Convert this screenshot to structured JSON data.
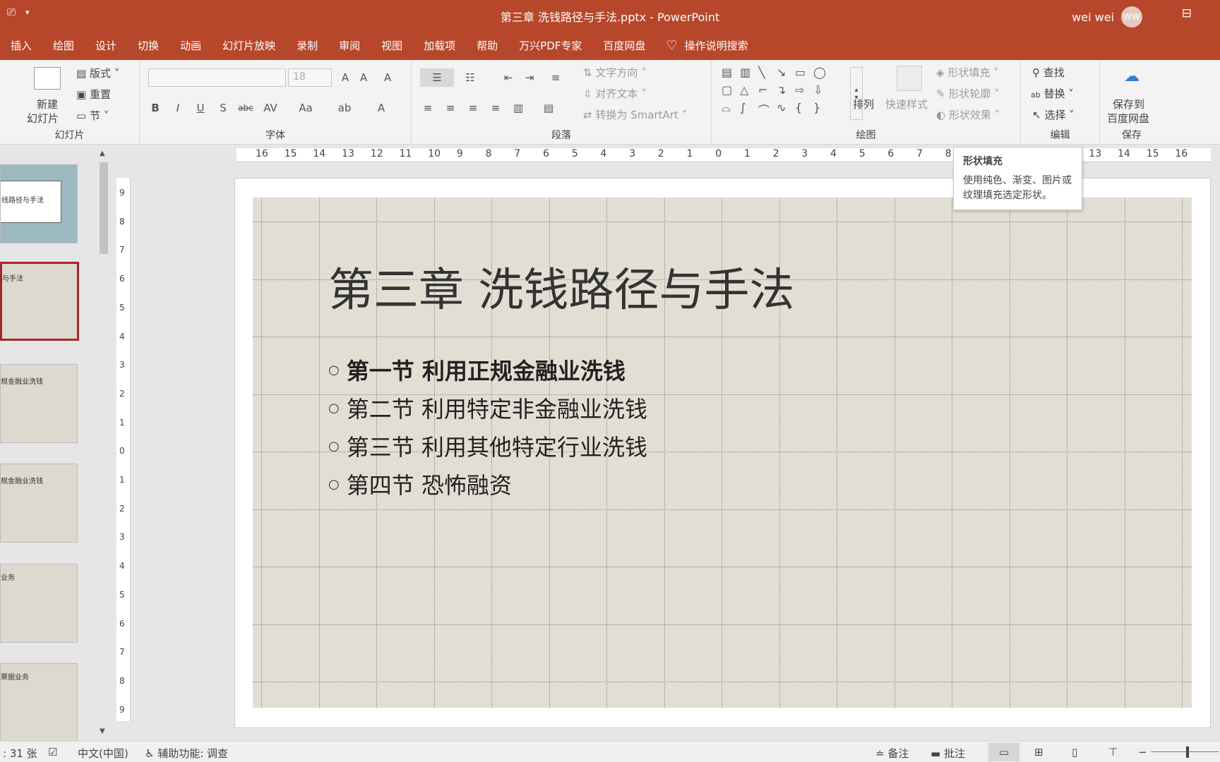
{
  "window": {
    "title": "第三章 洗钱路径与手法.pptx  -  PowerPoint",
    "user": "wei wei",
    "avatar": "WW"
  },
  "tabs": [
    "插入",
    "绘图",
    "设计",
    "切换",
    "动画",
    "幻灯片放映",
    "录制",
    "审阅",
    "视图",
    "加载项",
    "帮助",
    "万兴PDF专家",
    "百度网盘"
  ],
  "tellme": "操作说明搜索",
  "ribbon": {
    "slides": {
      "new": "新建",
      "new2": "幻灯片",
      "layout": "版式",
      "reset": "重置",
      "section": "节",
      "label": "幻灯片"
    },
    "font": {
      "size": "18",
      "label": "字体"
    },
    "paragraph": {
      "text_dir": "文字方向",
      "align_text": "对齐文本",
      "smartart": "转换为 SmartArt",
      "label": "段落"
    },
    "drawing": {
      "arrange": "排列",
      "quick_styles": "快速样式",
      "fill": "形状填充",
      "outline": "形状轮廓",
      "effects": "形状效果",
      "label": "绘图"
    },
    "editing": {
      "find": "查找",
      "replace": "替换",
      "select": "选择",
      "label": "编辑"
    },
    "save": {
      "line1": "保存到",
      "line2": "百度网盘",
      "label": "保存"
    }
  },
  "tooltip": {
    "title": "形状填充",
    "body": "使用纯色、渐变、图片或纹理填充选定形状。"
  },
  "thumbs": [
    "线路径与手法",
    "与手法",
    "规金融业洗钱",
    "规金融业洗钱",
    "业务",
    "票据业务"
  ],
  "slide": {
    "title": "第三章 洗钱路径与手法",
    "bullets": [
      "第一节 利用正规金融业洗钱",
      "第二节 利用特定非金融业洗钱",
      "第三节 利用其他特定行业洗钱",
      "第四节 恐怖融资"
    ]
  },
  "ruler": {
    "h": [
      "16",
      "15",
      "14",
      "13",
      "12",
      "11",
      "10",
      "9",
      "8",
      "7",
      "6",
      "5",
      "4",
      "3",
      "2",
      "1",
      "0",
      "1",
      "2",
      "3",
      "4",
      "5",
      "6",
      "7",
      "8",
      "9",
      "10",
      "11",
      "12",
      "13",
      "14",
      "15",
      "16"
    ],
    "v": [
      "9",
      "8",
      "7",
      "6",
      "5",
      "4",
      "3",
      "2",
      "1",
      "0",
      "1",
      "2",
      "3",
      "4",
      "5",
      "6",
      "7",
      "8",
      "9"
    ]
  },
  "status": {
    "slides": "31 张",
    "lang": "中文(中国)",
    "access": "辅助功能: 调查",
    "notes": "备注",
    "comments": "批注"
  }
}
